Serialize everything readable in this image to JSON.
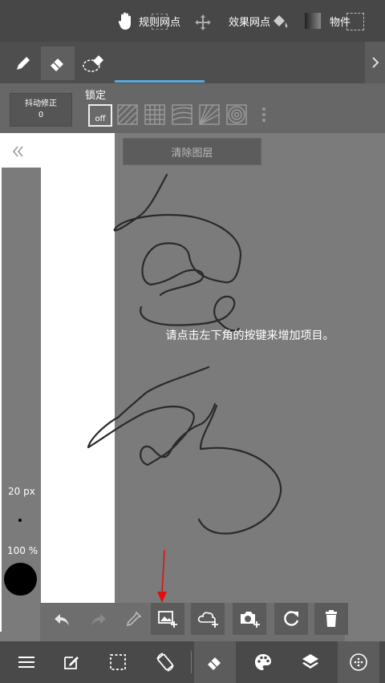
{
  "toolbar": {
    "tabs": [
      {
        "label": "规则网点"
      },
      {
        "label": "效果网点"
      },
      {
        "label": "物件"
      }
    ]
  },
  "subbar": {
    "stabilizer_label": "抖动修正",
    "stabilizer_value": "0",
    "lock_label": "锁定",
    "lock_state": "off"
  },
  "canvas": {
    "clear_layer_label": "清除图层",
    "hint": "请点击左下角的按键来增加项目。"
  },
  "side": {
    "brush_size": "20 px",
    "opacity": "100 %"
  },
  "colors": {
    "accent": "#55aadf",
    "annotation_arrow": "#e01010"
  }
}
